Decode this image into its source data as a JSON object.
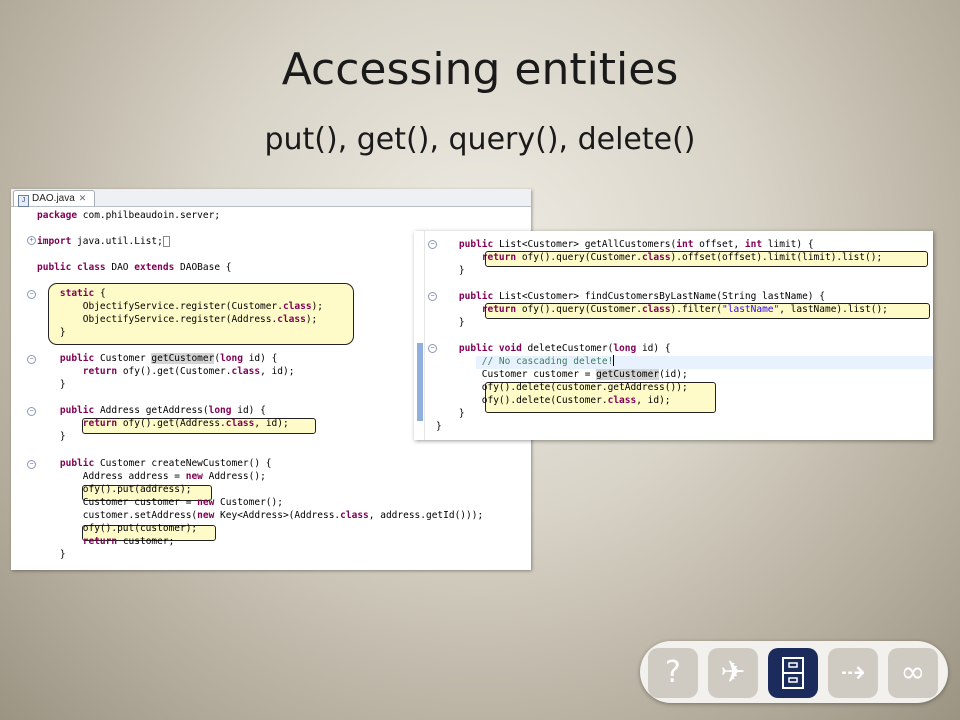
{
  "slide": {
    "title": "Accessing entities",
    "subtitle": "put(), get(), query(), delete()"
  },
  "editor": {
    "tab_label": "DAO.java",
    "tab_close": "✕",
    "file_icon": "J",
    "lines": [
      "package com.philbeaudoin.server;",
      "",
      "import java.util.List;",
      "",
      "public class DAO extends DAOBase {",
      "",
      "    static {",
      "        ObjectifyService.register(Customer.class);",
      "        ObjectifyService.register(Address.class);",
      "    }",
      "",
      "    public Customer getCustomer(long id) {",
      "        return ofy().get(Customer.class, id);",
      "    }",
      "",
      "    public Address getAddress(long id) {",
      "        return ofy().get(Address.class, id);",
      "    }",
      "",
      "    public Customer createNewCustomer() {",
      "        Address address = new Address();",
      "        ofy().put(address);",
      "        Customer customer = new Customer();",
      "        customer.setAddress(new Key<Address>(Address.class, address.getId()));",
      "        ofy().put(customer);",
      "        return customer;",
      "    }"
    ]
  },
  "editor2": {
    "lines": [
      "    public List<Customer> getAllCustomers(int offset, int limit) {",
      "        return ofy().query(Customer.class).offset(offset).limit(limit).list();",
      "    }",
      "",
      "    public List<Customer> findCustomersByLastName(String lastName) {",
      "        return ofy().query(Customer.class).filter(\"lastName\", lastName).list();",
      "    }",
      "",
      "    public void deleteCustomer(long id) {",
      "        // No cascading delete!",
      "        Customer customer = getCustomer(id);",
      "        ofy().delete(customer.getAddress());",
      "        ofy().delete(Customer.class, id);",
      "    }",
      "}"
    ]
  },
  "nav": {
    "help_icon": "?",
    "plane_icon": "✈",
    "cabinet_icon": "▯",
    "arrow_icon": "⇢",
    "glasses_icon": "∞"
  },
  "colors": {
    "keyword": "#7f0055",
    "string": "#2a00ff",
    "comment": "#3f7f5f",
    "highlight_box": "#fffbc8",
    "nav_active": "#1b2c5c"
  }
}
